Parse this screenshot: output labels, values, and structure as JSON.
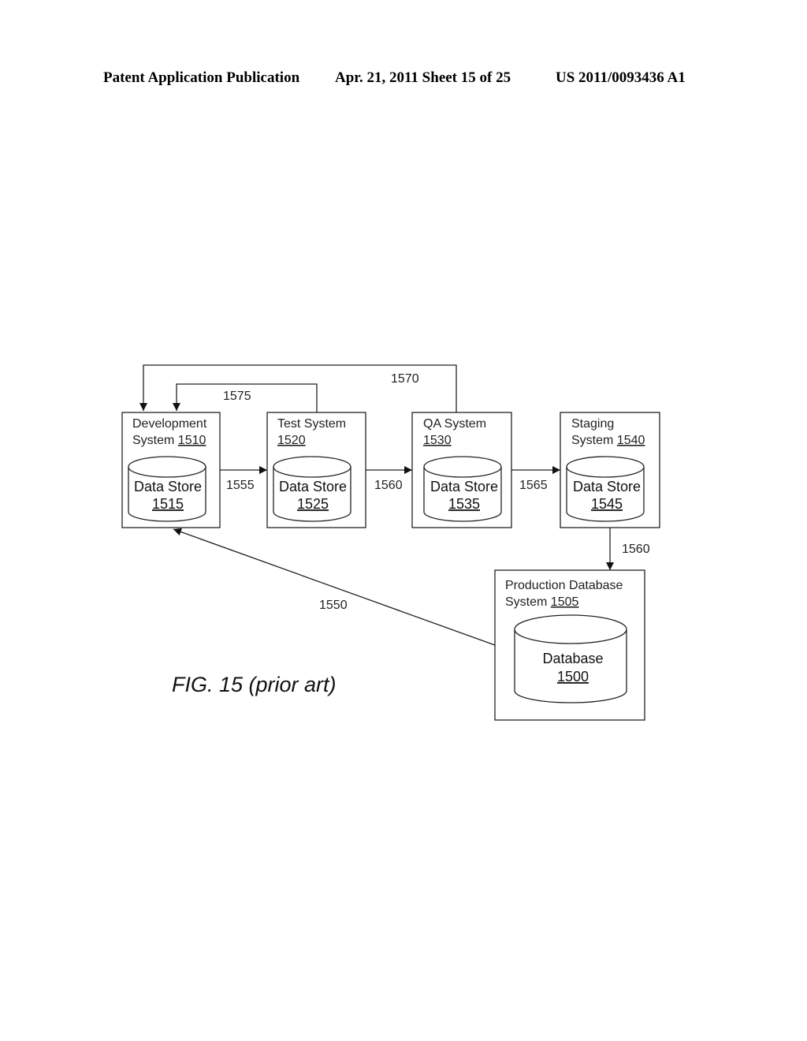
{
  "header": {
    "publication": "Patent Application Publication",
    "date_sheet": "Apr. 21, 2011  Sheet 15 of 25",
    "number": "US 2011/0093436 A1"
  },
  "systems": [
    {
      "line1": "Development",
      "line2": "System ",
      "ref": "1510",
      "store_label": "Data Store",
      "store_ref": "1515"
    },
    {
      "line1": "Test System",
      "line2": "",
      "ref": "1520",
      "store_label": "Data Store",
      "store_ref": "1525"
    },
    {
      "line1": "QA System",
      "line2": "",
      "ref": "1530",
      "store_label": "Data Store",
      "store_ref": "1535"
    },
    {
      "line1": "Staging",
      "line2": "System ",
      "ref": "1540",
      "store_label": "Data Store",
      "store_ref": "1545"
    }
  ],
  "production": {
    "line1": "Production Database",
    "line2": "System ",
    "ref": "1505",
    "db_label": "Database",
    "db_ref": "1500"
  },
  "arrows": {
    "dev_to_test": "1555",
    "test_to_qa": "1560",
    "qa_to_staging": "1565",
    "staging_to_prod": "1560",
    "prod_to_dev": "1550",
    "qa_to_dev": "1570",
    "test_to_dev": "1575"
  },
  "caption": "FIG. 15 (prior art)"
}
